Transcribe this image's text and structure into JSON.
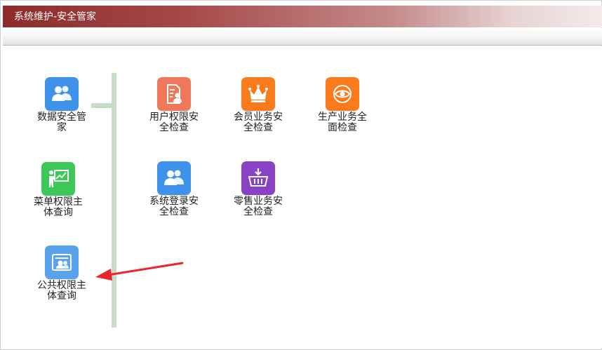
{
  "window": {
    "title": "系统维护-安全管家"
  },
  "colors": {
    "title_bar": "#8e2a2a",
    "connector": "#c6dcc6",
    "arrow": "#e8262b",
    "blue": "#3e92e9",
    "green": "#3ec85a",
    "pale_blue": "#5aa3ec",
    "salmon": "#f0785a",
    "orange": "#fb7a1c",
    "purple": "#8a42c4"
  },
  "apps": [
    {
      "id": "data-security",
      "label": "数据安全管家",
      "icon": "users-icon",
      "color": "#3e92e9"
    },
    {
      "id": "menu-permission",
      "label": "菜单权限主体查询",
      "icon": "presentation-icon",
      "color": "#3ec85a"
    },
    {
      "id": "public-permission",
      "label": "公共权限主体查询",
      "icon": "id-card-icon",
      "color": "#5aa3ec"
    },
    {
      "id": "user-permission",
      "label": "用户权限安全检查",
      "icon": "document-user-icon",
      "color": "#f0785a"
    },
    {
      "id": "member-business",
      "label": "会员业务安全检查",
      "icon": "crown-icon",
      "color": "#fb7a1c"
    },
    {
      "id": "production-business",
      "label": "生产业务全面检查",
      "icon": "eye-icon",
      "color": "#fb7a1c"
    },
    {
      "id": "system-login",
      "label": "系统登录安全检查",
      "icon": "users-icon",
      "color": "#3e92e9"
    },
    {
      "id": "retail-business",
      "label": "零售业务安全检查",
      "icon": "basket-icon",
      "color": "#8a42c4"
    }
  ]
}
